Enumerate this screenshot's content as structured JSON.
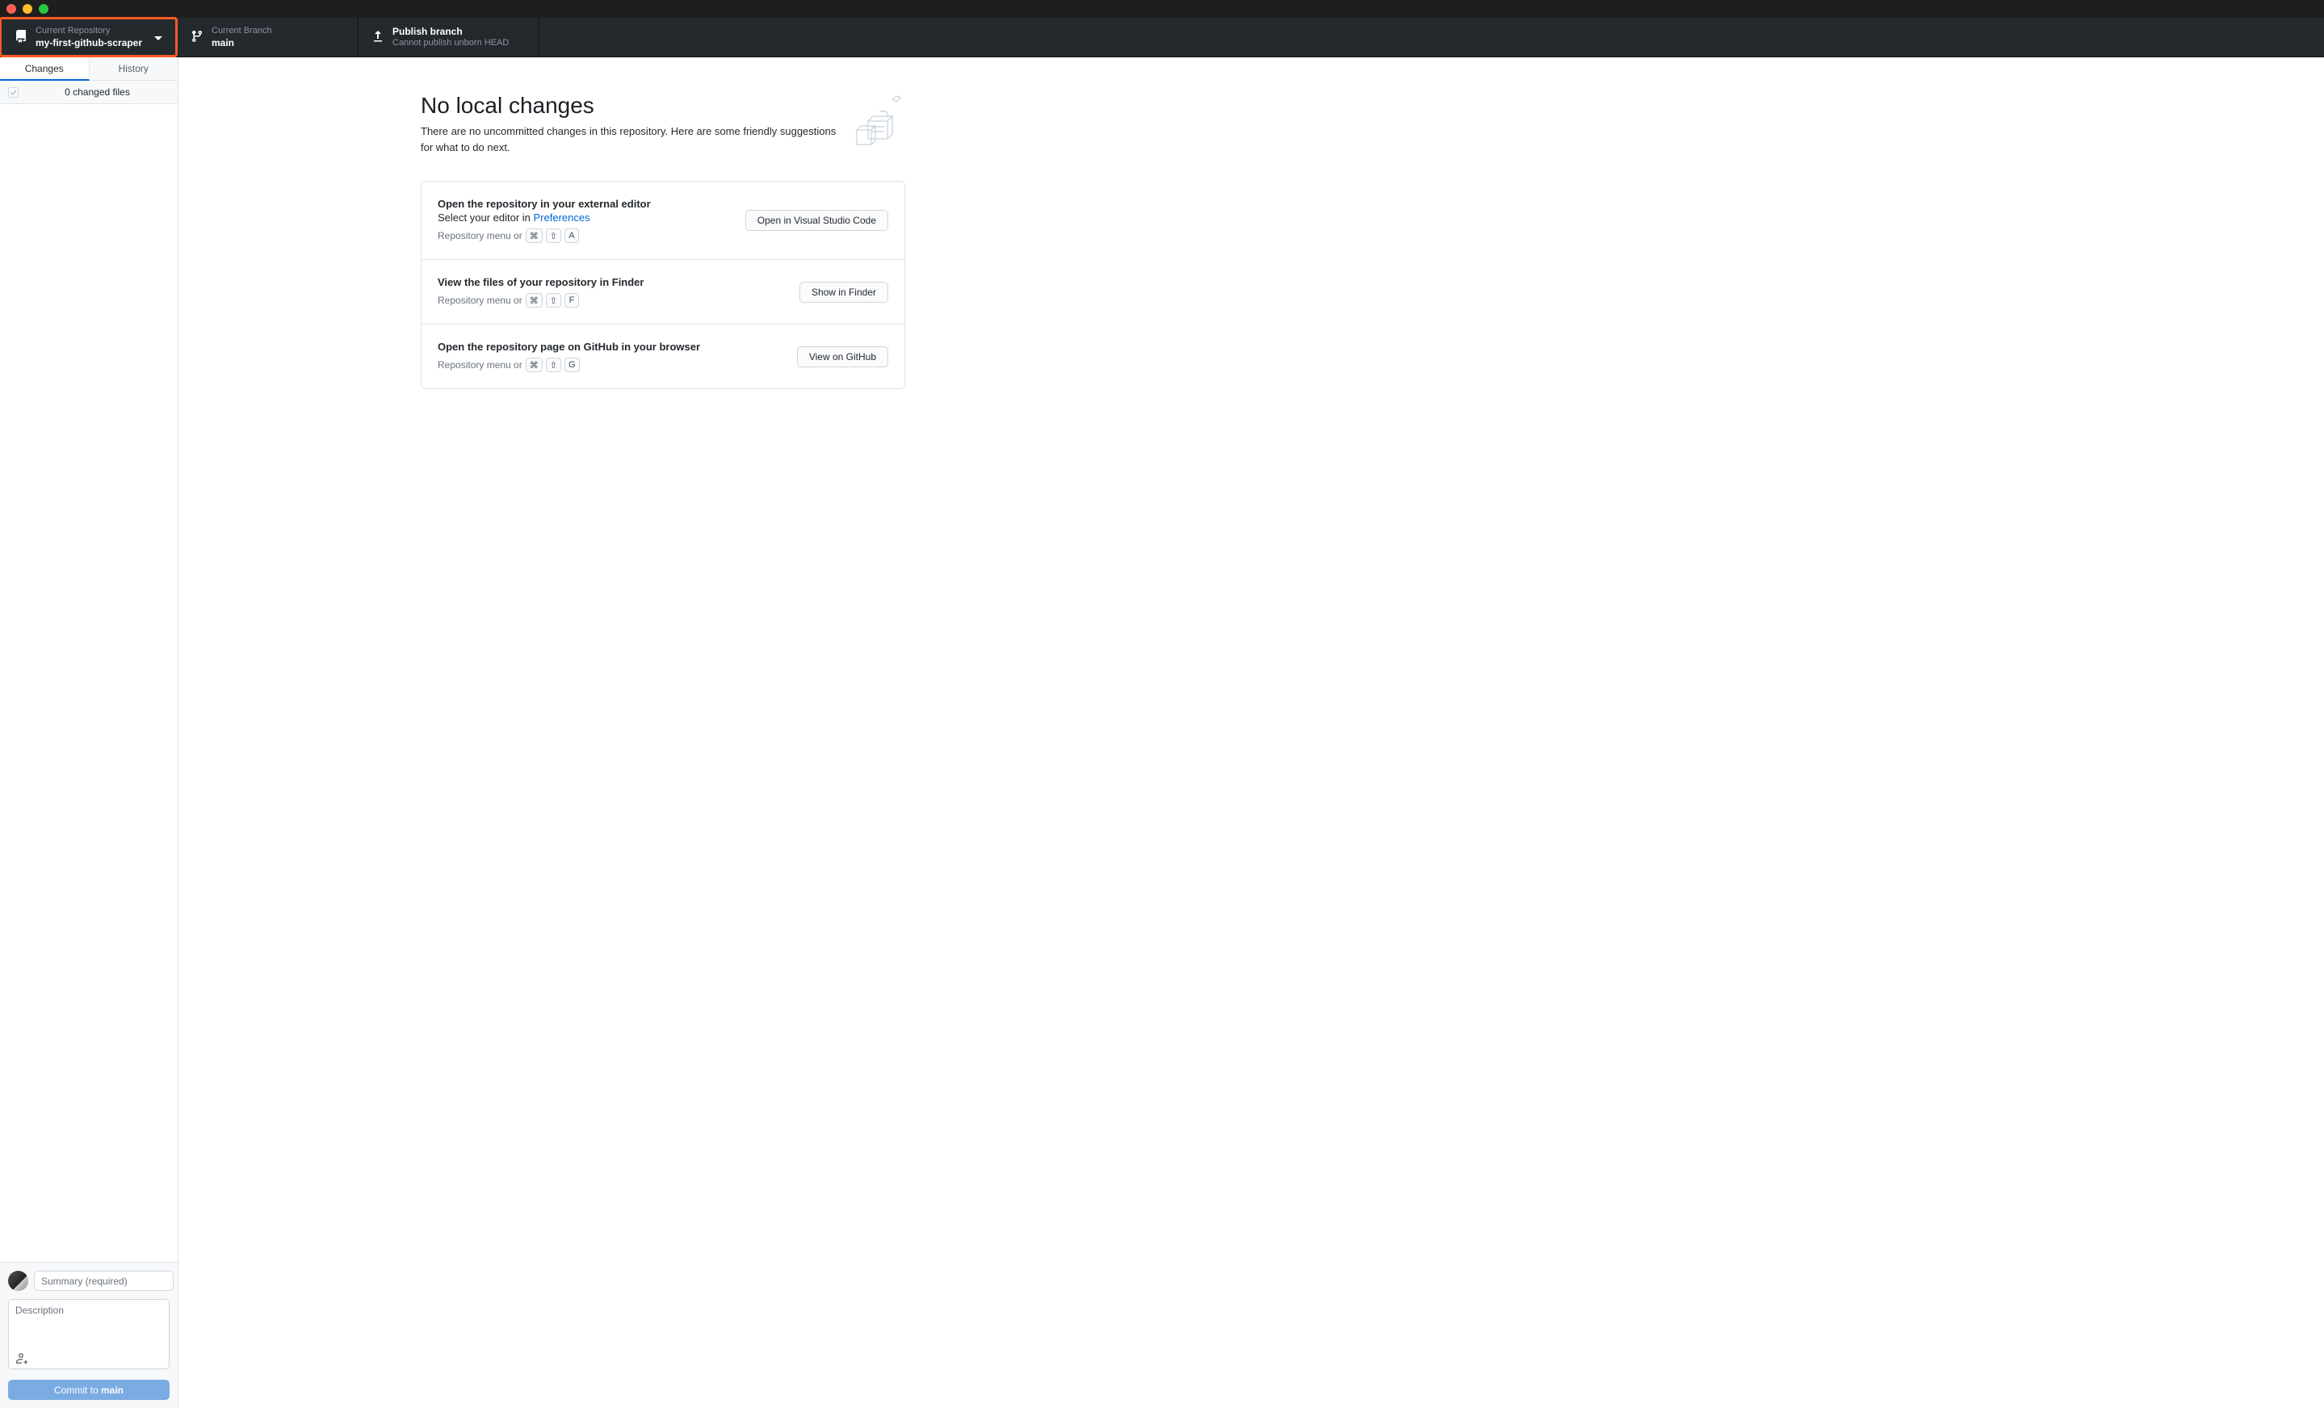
{
  "toolbar": {
    "repo": {
      "label": "Current Repository",
      "value": "my-first-github-scraper"
    },
    "branch": {
      "label": "Current Branch",
      "value": "main"
    },
    "publish": {
      "label": "Publish branch",
      "value": "Cannot publish unborn HEAD"
    }
  },
  "sidebar": {
    "tabs": {
      "changes": "Changes",
      "history": "History"
    },
    "changes_count": "0 changed files",
    "summary_placeholder": "Summary (required)",
    "desc_placeholder": "Description",
    "commit_prefix": "Commit to ",
    "commit_branch": "main"
  },
  "main": {
    "title": "No local changes",
    "subtitle": "There are no uncommitted changes in this repository. Here are some friendly suggestions for what to do next.",
    "cards": [
      {
        "title": "Open the repository in your external editor",
        "sub_prefix": "Select your editor in ",
        "sub_link": "Preferences",
        "meta_prefix": "Repository menu or",
        "keys": [
          "⌘",
          "⇧",
          "A"
        ],
        "button": "Open in Visual Studio Code"
      },
      {
        "title": "View the files of your repository in Finder",
        "meta_prefix": "Repository menu or",
        "keys": [
          "⌘",
          "⇧",
          "F"
        ],
        "button": "Show in Finder"
      },
      {
        "title": "Open the repository page on GitHub in your browser",
        "meta_prefix": "Repository menu or",
        "keys": [
          "⌘",
          "⇧",
          "G"
        ],
        "button": "View on GitHub"
      }
    ]
  }
}
